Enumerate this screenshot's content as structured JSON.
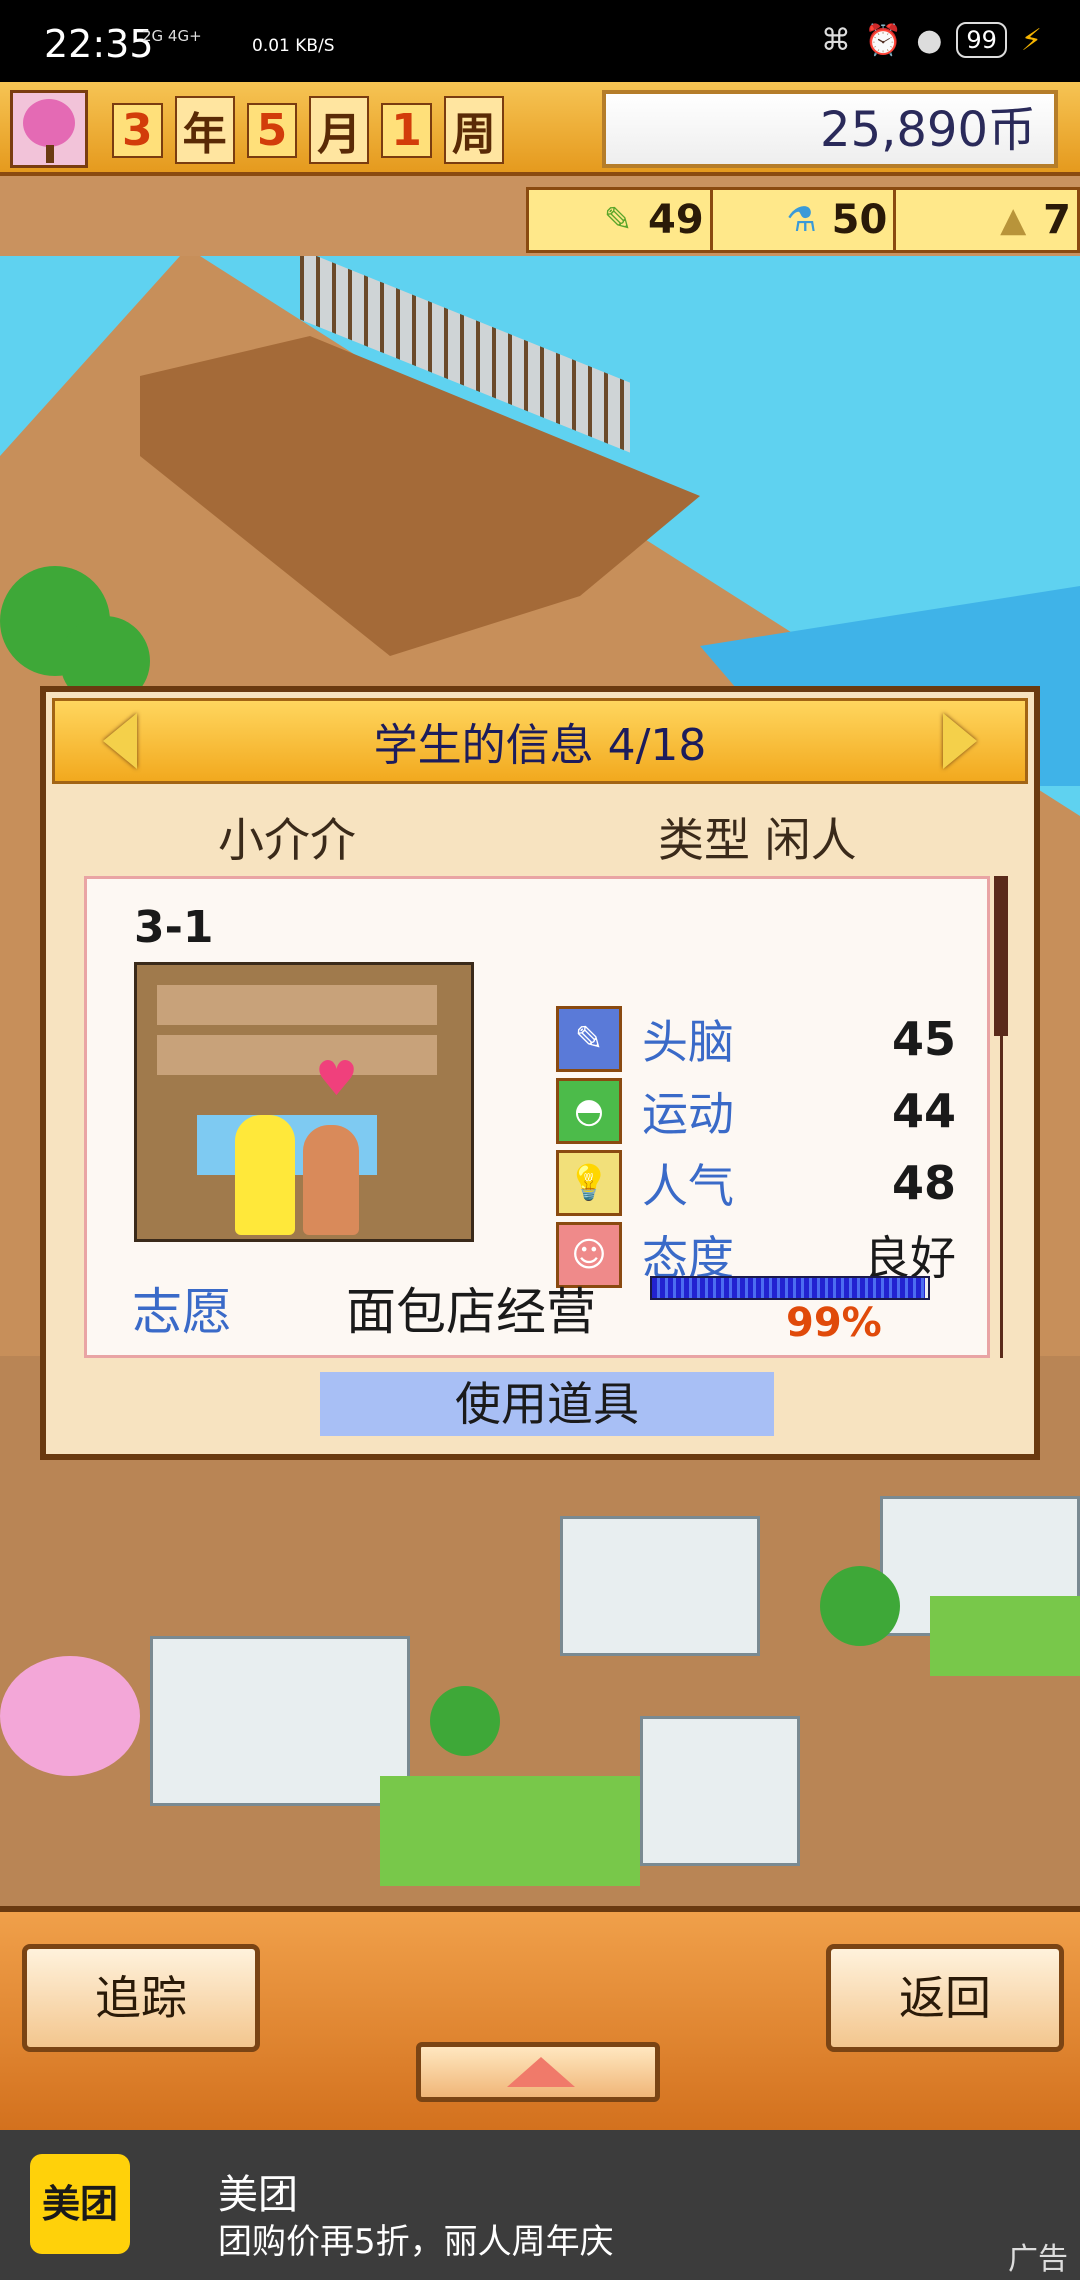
{
  "status_bar": {
    "time": "22:35",
    "network": "2G  4G+",
    "speed": "0.01 KB/S",
    "battery": "99"
  },
  "top_bar": {
    "year_num": "3",
    "year_unit": "年",
    "month_num": "5",
    "month_unit": "月",
    "week_num": "1",
    "week_unit": "周",
    "money": "25,890币"
  },
  "resources": [
    {
      "icon": "pencil-icon",
      "value": "49"
    },
    {
      "icon": "flask-icon",
      "value": "50"
    },
    {
      "icon": "pyramid-icon",
      "value": "7"
    }
  ],
  "dialog": {
    "title": "学生的信息 4/18",
    "student_name": "小介介",
    "student_type": "类型 闲人",
    "class_label": "3-1",
    "stats": [
      {
        "name": "头脑",
        "value": "45",
        "icon": "brain-icon",
        "color": "#5a7ad8"
      },
      {
        "name": "运动",
        "value": "44",
        "icon": "shoe-icon",
        "color": "#4cbb4a"
      },
      {
        "name": "人气",
        "value": "48",
        "icon": "bulb-icon",
        "color": "#f2e07a"
      },
      {
        "name": "态度",
        "value": "良好",
        "icon": "smile-icon",
        "color": "#ef8a8a"
      }
    ],
    "wish_label": "志愿",
    "wish_value": "面包店经营",
    "wish_progress": 0.99,
    "wish_percent": "99%",
    "use_item_label": "使用道具"
  },
  "bottom": {
    "track_label": "追踪",
    "back_label": "返回"
  },
  "ad": {
    "logo": "美团",
    "title": "美团",
    "desc": "团购价再5折，丽人周年庆",
    "tag": "广告"
  }
}
